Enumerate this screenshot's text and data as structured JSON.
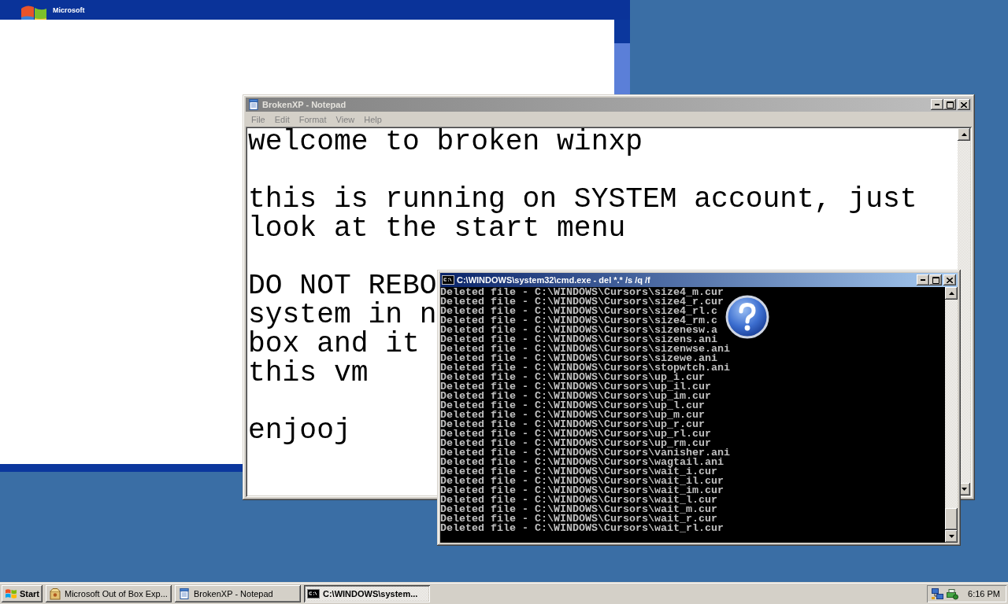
{
  "setup_window": {
    "logo": {
      "company": "Microsoft"
    }
  },
  "notepad": {
    "title": "BrokenXP - Notepad",
    "active": false,
    "menu": [
      "File",
      "Edit",
      "Format",
      "View",
      "Help"
    ],
    "paragraphs": [
      [
        "welcome to broken winxp"
      ],
      [
        "this is running on SYSTEM account, just",
        "look at the start menu"
      ],
      [
        "DO NOT REBO",
        "system in n",
        "box and it",
        "this vm"
      ],
      [
        "enjooj"
      ]
    ]
  },
  "console": {
    "title": "C:\\WINDOWS\\system32\\cmd.exe - del *.* /s /q /f",
    "active": true,
    "lines": [
      "Deleted file - C:\\WINDOWS\\Cursors\\size4_m.cur",
      "Deleted file - C:\\WINDOWS\\Cursors\\size4_r.cur",
      "Deleted file - C:\\WINDOWS\\Cursors\\size4_rl.c",
      "Deleted file - C:\\WINDOWS\\Cursors\\size4_rm.c",
      "Deleted file - C:\\WINDOWS\\Cursors\\sizenesw.a",
      "Deleted file - C:\\WINDOWS\\Cursors\\sizens.ani",
      "Deleted file - C:\\WINDOWS\\Cursors\\sizenwse.ani",
      "Deleted file - C:\\WINDOWS\\Cursors\\sizewe.ani",
      "Deleted file - C:\\WINDOWS\\Cursors\\stopwtch.ani",
      "Deleted file - C:\\WINDOWS\\Cursors\\up_i.cur",
      "Deleted file - C:\\WINDOWS\\Cursors\\up_il.cur",
      "Deleted file - C:\\WINDOWS\\Cursors\\up_im.cur",
      "Deleted file - C:\\WINDOWS\\Cursors\\up_l.cur",
      "Deleted file - C:\\WINDOWS\\Cursors\\up_m.cur",
      "Deleted file - C:\\WINDOWS\\Cursors\\up_r.cur",
      "Deleted file - C:\\WINDOWS\\Cursors\\up_rl.cur",
      "Deleted file - C:\\WINDOWS\\Cursors\\up_rm.cur",
      "Deleted file - C:\\WINDOWS\\Cursors\\vanisher.ani",
      "Deleted file - C:\\WINDOWS\\Cursors\\wagtail.ani",
      "Deleted file - C:\\WINDOWS\\Cursors\\wait_i.cur",
      "Deleted file - C:\\WINDOWS\\Cursors\\wait_il.cur",
      "Deleted file - C:\\WINDOWS\\Cursors\\wait_im.cur",
      "Deleted file - C:\\WINDOWS\\Cursors\\wait_l.cur",
      "Deleted file - C:\\WINDOWS\\Cursors\\wait_m.cur",
      "Deleted file - C:\\WINDOWS\\Cursors\\wait_r.cur",
      "Deleted file - C:\\WINDOWS\\Cursors\\wait_rl.cur"
    ]
  },
  "taskbar": {
    "start": "Start",
    "tasks": [
      {
        "label": "Microsoft Out of Box Exp...",
        "kind": "setup",
        "selected": false
      },
      {
        "label": "BrokenXP - Notepad",
        "kind": "notepad",
        "selected": false
      },
      {
        "label": "C:\\WINDOWS\\system...",
        "kind": "console",
        "selected": true
      }
    ],
    "clock": "6:16 PM"
  }
}
